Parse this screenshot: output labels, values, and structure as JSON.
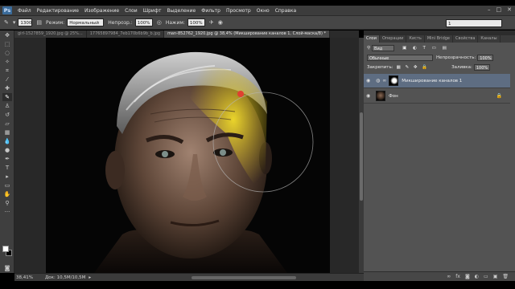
{
  "app": {
    "logo": "Ps",
    "menu": [
      "Файл",
      "Редактирование",
      "Изображение",
      "Слои",
      "Шрифт",
      "Выделение",
      "Фильтр",
      "Просмотр",
      "Окно",
      "Справка"
    ]
  },
  "options": {
    "brush_size": "1300",
    "mode_label": "Режим:",
    "mode_value": "Нормальный",
    "opacity_label": "Непрозр.:",
    "opacity_value": "100%",
    "flow_label": "Нажим:",
    "flow_value": "100%",
    "right_field": "1"
  },
  "tabs": [
    "girl-1527859_1920.jpg @ 25%...",
    "17765897984_7eb170b6b9b_b.jpg",
    "man-852762_1920.jpg @ 38,4% (Микширование каналов 1, Слой-маска/8) *"
  ],
  "status": {
    "zoom": "38,41%",
    "doc": "Док: 10,5M/10,5M"
  },
  "panel": {
    "tabs": [
      "Слои",
      "Операции",
      "Кисть",
      "Mini Bridge",
      "Свойства",
      "Каналы"
    ],
    "filter_label": "Вид",
    "blend_mode": "Обычные",
    "opacity_label": "Непрозрачность:",
    "opacity_value": "100%",
    "lock_label": "Закрепить:",
    "fill_label": "Заливка:",
    "fill_value": "100%",
    "layers": [
      {
        "name": "Микширование каналов 1",
        "selected": true
      },
      {
        "name": "Фон",
        "selected": false
      }
    ]
  },
  "colors": {
    "highlight": "#e8d12a",
    "selection": "#5e6d82"
  }
}
